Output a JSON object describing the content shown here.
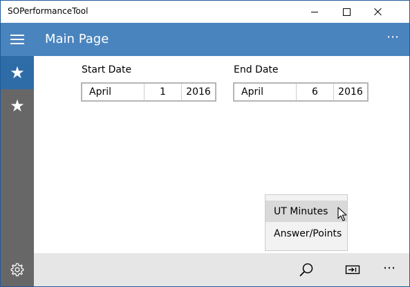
{
  "window": {
    "app_title": "SOPerformanceTool"
  },
  "header": {
    "page_title": "Main Page",
    "more_label": "⋯"
  },
  "nav": {
    "items": [
      {
        "icon": "star-icon",
        "glyph": "★",
        "active": true
      },
      {
        "icon": "star-icon",
        "glyph": "★",
        "active": false
      }
    ],
    "settings_icon": "gear-icon"
  },
  "start_date": {
    "label": "Start Date",
    "month": "April",
    "day": "1",
    "year": "2016"
  },
  "end_date": {
    "label": "End Date",
    "month": "April",
    "day": "6",
    "year": "2016"
  },
  "menu": {
    "items": [
      {
        "label": "UT Minutes",
        "highlighted": true
      },
      {
        "label": "Answer/Points",
        "highlighted": false
      }
    ]
  },
  "bottombar": {
    "search_icon": "search-icon",
    "display_icon": "project-icon",
    "more_label": "⋯"
  },
  "colors": {
    "accent": "#4a84be",
    "nav_active": "#2e6ca8",
    "nav_bg": "#676767",
    "bottombar_bg": "#e6e6e6"
  }
}
